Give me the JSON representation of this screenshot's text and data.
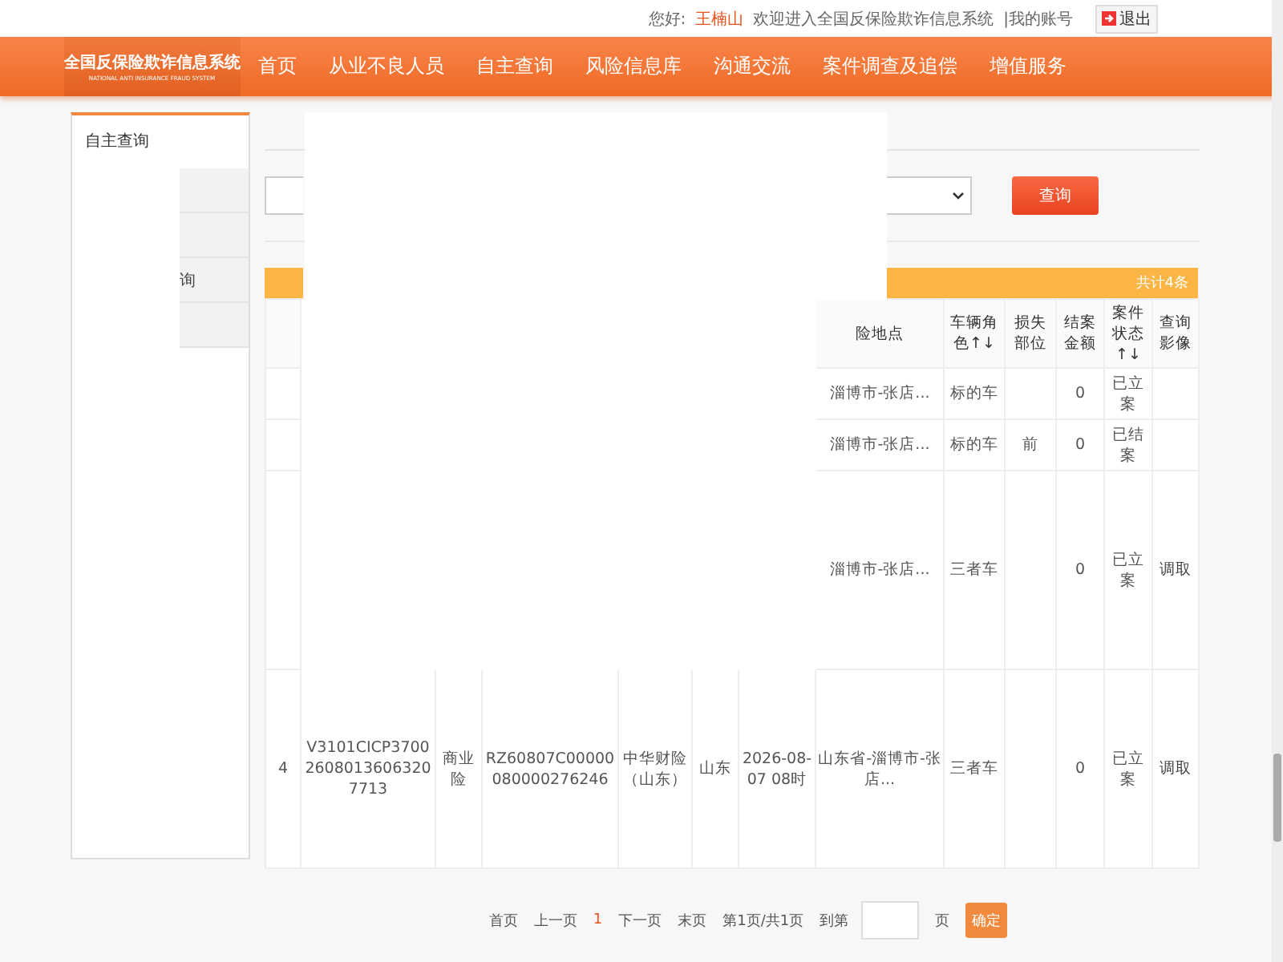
{
  "top_bar": {
    "greeting": "您好:",
    "user": "王楠山",
    "welcome": "欢迎进入全国反保险欺诈信息系统",
    "account_link": "|我的账号",
    "logout": "退出"
  },
  "header": {
    "logo_title": "全国反保险欺诈信息系统",
    "logo_subtitle": "NATIONAL ANTI INSURANCE FRAUD SYSTEM",
    "nav": [
      {
        "label": "首页"
      },
      {
        "label": "从业不良人员"
      },
      {
        "label": "自主查询"
      },
      {
        "label": "风险信息库"
      },
      {
        "label": "沟通交流"
      },
      {
        "label": "案件调查及追偿"
      },
      {
        "label": "增值服务"
      }
    ]
  },
  "sidebar": {
    "title": "自主查询",
    "items": [
      {
        "kind": "blank"
      },
      {
        "kind": "blank"
      },
      {
        "kind": "text",
        "label": "询"
      },
      {
        "kind": "blank"
      }
    ]
  },
  "search": {
    "button": "查询"
  },
  "table": {
    "total": "共计4条",
    "columns": [
      null,
      null,
      null,
      null,
      null,
      null,
      null,
      "险地点",
      "车辆角色↑↓",
      "损失部位",
      "结案金额",
      "案件状态↑↓",
      "查询影像"
    ],
    "rows": [
      [
        null,
        null,
        null,
        null,
        null,
        null,
        null,
        "淄博市-张店...",
        "标的车",
        null,
        "0",
        "已立案",
        null
      ],
      [
        null,
        null,
        null,
        null,
        null,
        null,
        null,
        "淄博市-张店...",
        "标的车",
        "前",
        "0",
        "已结案",
        null
      ],
      [
        null,
        null,
        null,
        null,
        null,
        null,
        null,
        "淄博市-张店...",
        "三者车",
        null,
        "0",
        "已立案",
        "调取"
      ],
      [
        "4",
        "V3101CICP370026080136063207713",
        "商业险",
        "RZ60807C00000080000276246",
        "中华财险（山东）",
        "山东",
        "2026-08-07 08时",
        "山东省-淄博市-张店...",
        "三者车",
        null,
        "0",
        "已立案",
        "调取"
      ]
    ]
  },
  "pager": {
    "first": "首页",
    "prev": "上一页",
    "current": "1",
    "next": "下一页",
    "last": "末页",
    "info": "第1页/共1页",
    "goto": "到第",
    "unit": "页",
    "confirm": "确定"
  }
}
